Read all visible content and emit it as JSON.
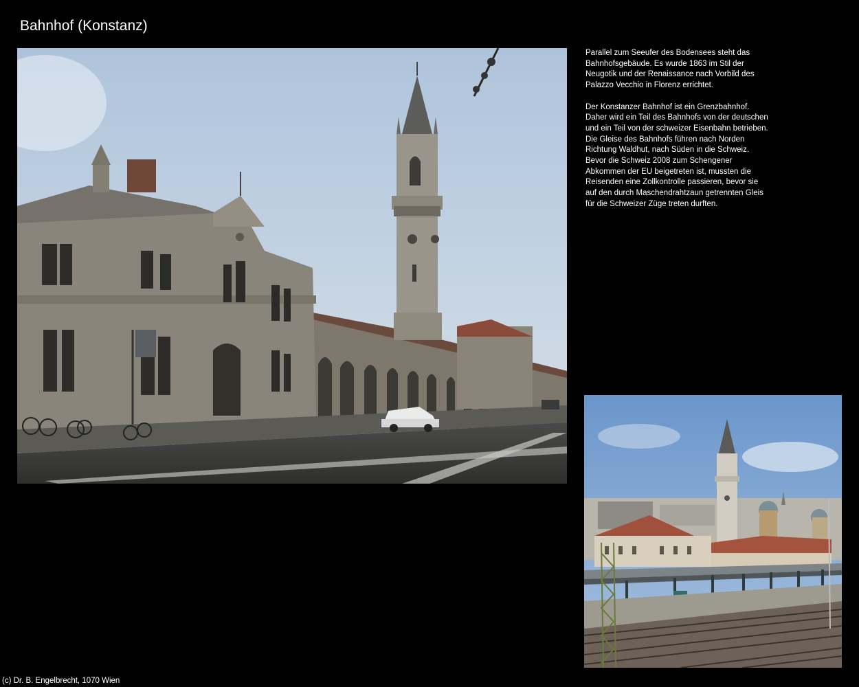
{
  "page": {
    "title": "Bahnhof (Konstanz)",
    "footer": "(c) Dr. B. Engelbrecht, 1070 Wien"
  },
  "description": {
    "paragraph1": "Parallel zum Seeufer des Bodensees steht das Bahnhofsgebäude. Es wurde 1863 im Stil der Neugotik und der Renaissance nach Vorbild des Palazzo Vecchio in Florenz errichtet.",
    "paragraph2": "Der Konstanzer Bahnhof ist ein Grenzbahnhof. Daher wird ein Teil des Bahnhofs von der deutschen und ein Teil von der schweizer Eisenbahn betrieben. Die Gleise des Bahnhofs führen nach Norden Richtung Waldhut, nach Süden in die Schweiz. Bevor die Schweiz 2008 zum Schengener Abkommen der EU beigetreten ist, mussten die Reisenden eine Zollkontrolle passieren, bevor sie auf den durch Maschendrahtzaun getrennten Gleis für die Schweizer Züge treten durften."
  },
  "colors": {
    "background": "#000000",
    "text": "#ffffff",
    "sky_main": "#c3d3e3",
    "stone": "#8a857a",
    "sky_second": "#7ea5d4",
    "roof_red": "#a0503c"
  }
}
